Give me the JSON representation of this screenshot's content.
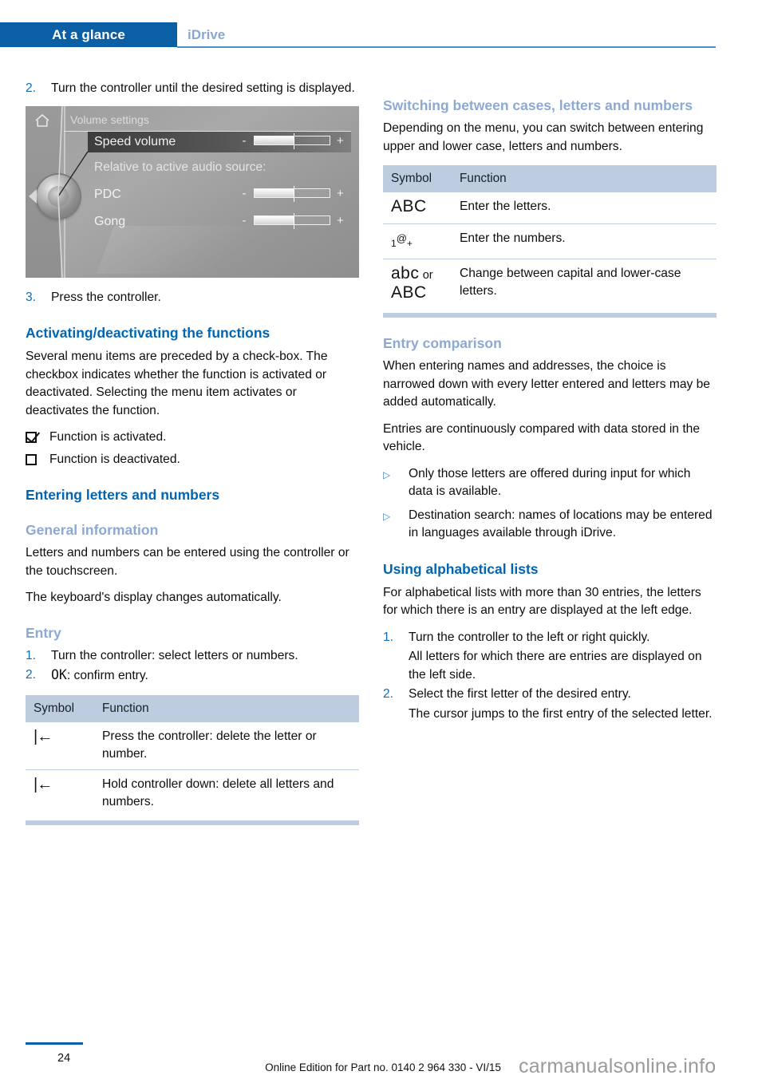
{
  "header": {
    "active_tab": "At a glance",
    "inactive_tab": "iDrive"
  },
  "left_column": {
    "step2": {
      "num": "2.",
      "text": "Turn the controller until the desired setting is displayed."
    },
    "idrive_screen": {
      "home_icon": "home-icon",
      "title": "Volume settings",
      "selected_row_label": "Speed volume",
      "section_label": "Relative to active audio source:",
      "row_pdc_label": "PDC",
      "row_gong_label": "Gong",
      "minus": "-",
      "plus": "+"
    },
    "step3": {
      "num": "3.",
      "text": "Press the controller."
    },
    "heading_activating": "Activating/deactivating the functions",
    "para_checkbox": "Several menu items are preceded by a check-box. The checkbox indicates whether the function is activated or deactivated. Selecting the menu item activates or deactivates the function.",
    "checkbox_activated": "Function is activated.",
    "checkbox_deactivated": "Function is deactivated.",
    "heading_entering": "Entering letters and numbers",
    "heading_general": "General information",
    "para_general_1": "Letters and numbers can be entered using the controller or the touchscreen.",
    "para_general_2": "The keyboard's display changes automatically.",
    "heading_entry": "Entry",
    "entry_step1": {
      "num": "1.",
      "text": "Turn the controller: select letters or numbers."
    },
    "entry_step2": {
      "num": "2.",
      "symbol": "OK",
      "text": ": confirm entry."
    },
    "table": {
      "col_symbol": "Symbol",
      "col_function": "Function",
      "rows": [
        {
          "symbol": "|←",
          "function": "Press the controller: delete the letter or number."
        },
        {
          "symbol": "|←",
          "function": "Hold controller down: delete all letters and numbers."
        }
      ]
    }
  },
  "right_column": {
    "heading_switching": "Switching between cases, letters and numbers",
    "para_switching": "Depending on the menu, you can switch between entering upper and lower case, letters and numbers.",
    "table": {
      "col_symbol": "Symbol",
      "col_function": "Function",
      "rows": [
        {
          "symbol": "ABC",
          "function": "Enter the letters."
        },
        {
          "symbol_prefix": "1",
          "symbol_mid": "@",
          "symbol_suffix": "+",
          "function": "Enter the numbers."
        },
        {
          "symbol_a": "abc",
          "symbol_or": "or",
          "symbol_b": "ABC",
          "function": "Change between capital and lower-case letters."
        }
      ]
    },
    "heading_entry_comparison": "Entry comparison",
    "para_comparison_1": "When entering names and addresses, the choice is narrowed down with every letter entered and letters may be added automatically.",
    "para_comparison_2": "Entries are continuously compared with data stored in the vehicle.",
    "bullets": [
      "Only those letters are offered during input for which data is available.",
      "Destination search: names of locations may be entered in languages available through iDrive."
    ],
    "heading_alphabetical": "Using alphabetical lists",
    "para_alphabetical": "For alphabetical lists with more than 30 entries, the letters for which there is an entry are displayed at the left edge.",
    "alpha_step1": {
      "num": "1.",
      "text": "Turn the controller to the left or right quickly."
    },
    "alpha_step1_sub": "All letters for which there are entries are displayed on the left side.",
    "alpha_step2": {
      "num": "2.",
      "text": "Select the first letter of the desired entry."
    },
    "alpha_step2_sub": "The cursor jumps to the first entry of the selected letter."
  },
  "footer": {
    "page_number": "24",
    "edition": "Online Edition for Part no. 0140 2 964 330 - VI/15",
    "watermark": "carmanualsonline.info"
  }
}
